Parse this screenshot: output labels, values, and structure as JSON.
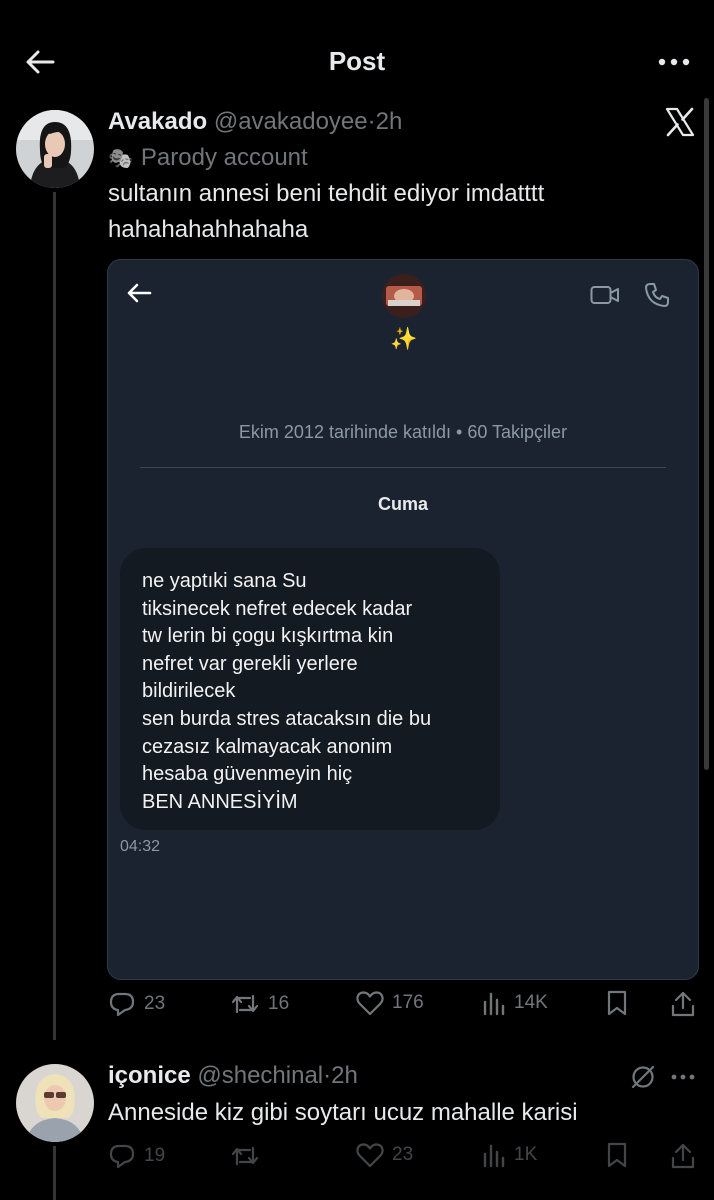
{
  "header": {
    "title": "Post"
  },
  "post": {
    "author_name": "Avakado",
    "author_handle": "@avakadoyee",
    "separator": "·",
    "time": "2h",
    "parody_emoji": "🎭",
    "parody_label": "Parody account",
    "text_lines": [
      "sultanın annesi beni tehdit ediyor imdatttt",
      "hahahahahhahaha"
    ],
    "media": {
      "sparkle": "✨",
      "joined": "Ekim 2012 tarihinde katıldı • 60 Takipçiler",
      "day": "Cuma",
      "message_lines": [
        "ne yaptıki sana Su",
        "tiksinecek nefret edecek kadar",
        "tw lerin bi çogu kışkırtma kin",
        "nefret var gerekli yerlere",
        "bildirilecek",
        "sen burda stres atacaksın die bu",
        "cezasız kalmayacak anonim",
        "hesaba güvenmeyin hiç",
        "BEN ANNESİYİM"
      ],
      "message_time": "04:32"
    },
    "stats": {
      "replies": "23",
      "reposts": "16",
      "likes": "176",
      "views": "14K"
    }
  },
  "reply": {
    "author_name": "içonice",
    "author_handle": "@shechinal",
    "separator": "·",
    "time": "2h",
    "text": "Anneside kiz gibi soytarı ucuz mahalle karisi",
    "stats": {
      "replies": "19",
      "likes": "23",
      "views": "1K"
    }
  },
  "colors": {
    "background": "#000000",
    "text": "#e7e9ea",
    "muted": "#71767b",
    "dm_panel": "#1b2330",
    "dm_bubble": "#141a22"
  },
  "icons": [
    "back-arrow-icon",
    "more-dots-icon",
    "x-logo-icon",
    "reply-icon",
    "repost-icon",
    "like-icon",
    "views-icon",
    "bookmark-icon",
    "share-icon",
    "video-call-icon",
    "phone-icon",
    "grok-icon"
  ]
}
